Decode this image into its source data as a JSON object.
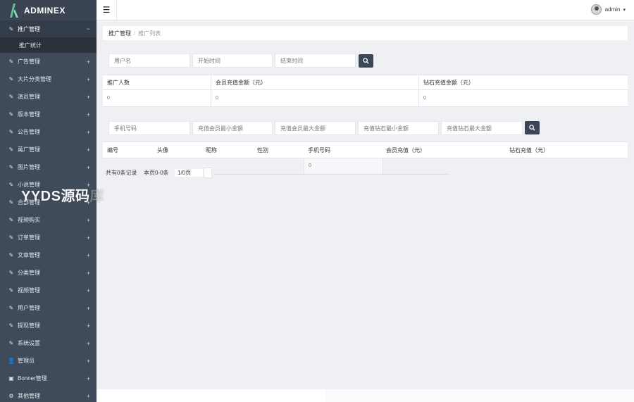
{
  "app": {
    "logo_text": "ADMINEX"
  },
  "sidebar": {
    "items": [
      {
        "label": "推广管理",
        "icon": "edit-icon",
        "expand": "−",
        "active": true
      },
      {
        "label": "广告管理",
        "icon": "edit-icon",
        "expand": "+"
      },
      {
        "label": "大片分类管理",
        "icon": "edit-icon",
        "expand": "+"
      },
      {
        "label": "演员管理",
        "icon": "edit-icon",
        "expand": "+"
      },
      {
        "label": "版本管理",
        "icon": "edit-icon",
        "expand": "+"
      },
      {
        "label": "公告管理",
        "icon": "edit-icon",
        "expand": "+"
      },
      {
        "label": "萬厂管理",
        "icon": "edit-icon",
        "expand": "+"
      },
      {
        "label": "图片管理",
        "icon": "edit-icon",
        "expand": "+"
      },
      {
        "label": "小说管理",
        "icon": "edit-icon",
        "expand": "+"
      },
      {
        "label": "合部管理",
        "icon": "edit-icon",
        "expand": "+"
      },
      {
        "label": "视频购买",
        "icon": "edit-icon",
        "expand": "+"
      },
      {
        "label": "订单管理",
        "icon": "edit-icon",
        "expand": "+"
      },
      {
        "label": "文章管理",
        "icon": "edit-icon",
        "expand": "+"
      },
      {
        "label": "分类管理",
        "icon": "edit-icon",
        "expand": "+"
      },
      {
        "label": "视频管理",
        "icon": "edit-icon",
        "expand": "+"
      },
      {
        "label": "用户管理",
        "icon": "edit-icon",
        "expand": "+"
      },
      {
        "label": "提现管理",
        "icon": "edit-icon",
        "expand": "+"
      },
      {
        "label": "系统设置",
        "icon": "edit-icon",
        "expand": "+"
      },
      {
        "label": "管理员",
        "icon": "user-icon",
        "expand": "+"
      },
      {
        "label": "Bonner管理",
        "icon": "image-icon",
        "expand": "+"
      },
      {
        "label": "其他管理",
        "icon": "gear-icon",
        "expand": "+"
      }
    ],
    "sub_item": "推广统计"
  },
  "header": {
    "menu_icon": "hamburger-icon",
    "user_name": "admin",
    "caret": "▾"
  },
  "breadcrumb": {
    "section": "推广管理",
    "separator": "/",
    "page": "推广列表"
  },
  "search1": {
    "username_placeholder": "用户名",
    "start_placeholder": "开始时间",
    "end_placeholder": "结束时间"
  },
  "stats_table": {
    "headers": [
      "推广人数",
      "会员充值金额（元）",
      "钻石充值金额（元）"
    ],
    "values": [
      "0",
      "0",
      "0"
    ]
  },
  "search2": {
    "phone_placeholder": "手机号码",
    "vip_min_placeholder": "充值会员最小金额",
    "vip_max_placeholder": "充值会员最大金额",
    "diamond_min_placeholder": "充值钻石最小金额",
    "diamond_max_placeholder": "充值钻石最大金额"
  },
  "list_table": {
    "headers": [
      "编号",
      "头像",
      "昵称",
      "性别",
      "手机号码",
      "会员充值（元）",
      "钻石充值（元）"
    ],
    "row_value": "0"
  },
  "pagination": {
    "total": "共有0条记录",
    "current": "本页0-0条",
    "page": "1/0页"
  },
  "watermark": {
    "main": "YYDS源码",
    "ghost": "库"
  }
}
